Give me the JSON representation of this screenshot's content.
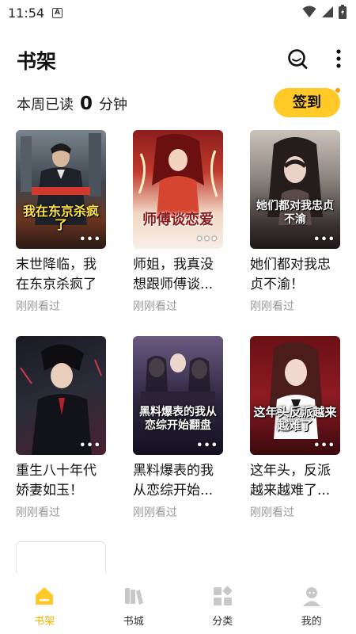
{
  "status": {
    "time": "11:54",
    "badge": "A"
  },
  "header": {
    "title": "书架"
  },
  "weekly": {
    "prefix": "本周已读",
    "minutes": "0",
    "suffix": "分钟"
  },
  "checkin": {
    "label": "签到"
  },
  "books": [
    {
      "title": "末世降临，我在东京杀疯了",
      "cover_text": "我在东京杀疯了",
      "status": "刚刚看过"
    },
    {
      "title": "师姐，我真没想跟师傅谈...",
      "cover_text": "师傅谈恋爱",
      "status": "刚刚看过"
    },
    {
      "title": "她们都对我忠贞不渝！",
      "cover_text": "她们都对我忠贞不渝",
      "status": "刚刚看过"
    },
    {
      "title": "重生八十年代娇妻如玉！",
      "cover_text": "",
      "status": "刚刚看过"
    },
    {
      "title": "黑料爆表的我从恋综开始...",
      "cover_text": "黑料爆表的我从恋综开始翻盘",
      "status": "刚刚看过"
    },
    {
      "title": "这年头，反派越来越难了...",
      "cover_text": "这年头反派越来越难了",
      "status": "刚刚看过"
    }
  ],
  "more_glyph": "•••",
  "tabs": [
    {
      "label": "书架"
    },
    {
      "label": "书城"
    },
    {
      "label": "分类"
    },
    {
      "label": "我的"
    }
  ],
  "colors": {
    "accent": "#ffc928",
    "active_tab": "#f5b400",
    "muted": "#999999"
  }
}
